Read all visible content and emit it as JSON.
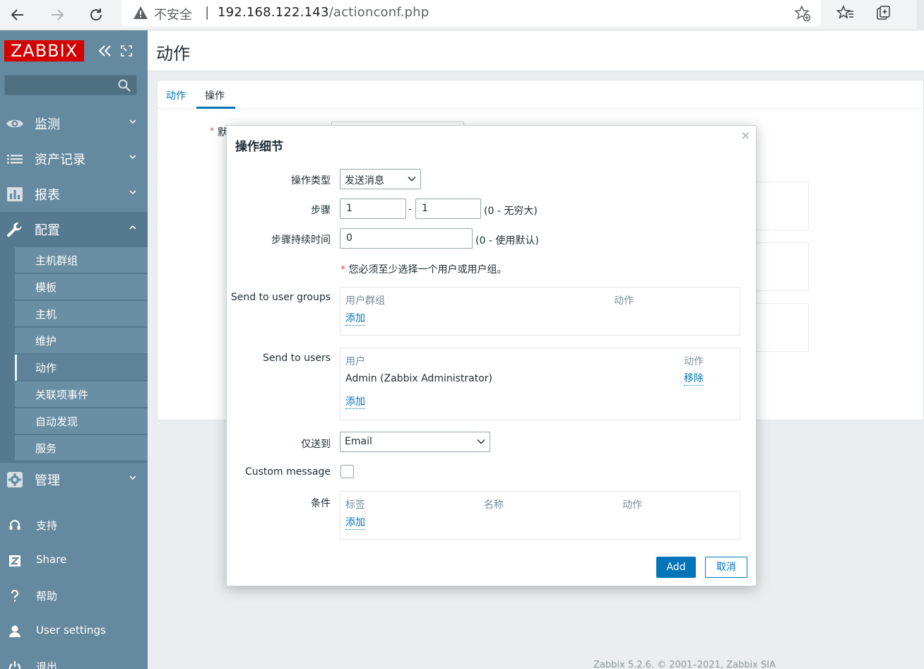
{
  "browser": {
    "security_label": "不安全",
    "separator": "|",
    "url_host": "192.168.122.143",
    "url_path": "/actionconf.php"
  },
  "sidebar": {
    "logo": "ZABBIX",
    "nav": [
      {
        "label": "监测",
        "icon": "eye-icon"
      },
      {
        "label": "资产记录",
        "icon": "list-icon"
      },
      {
        "label": "报表",
        "icon": "bar-chart-icon"
      },
      {
        "label": "配置",
        "icon": "wrench-icon"
      },
      {
        "label": "管理",
        "icon": "gear-icon"
      }
    ],
    "subnav": [
      "主机群组",
      "模板",
      "主机",
      "维护",
      "动作",
      "关联项事件",
      "自动发现",
      "服务"
    ],
    "bottom": [
      {
        "label": "支持",
        "icon": "headset-icon"
      },
      {
        "label": "Share",
        "icon": "share-z-icon"
      },
      {
        "label": "帮助",
        "icon": "question-icon"
      },
      {
        "label": "User settings",
        "icon": "user-icon"
      },
      {
        "label": "退出",
        "icon": "power-icon"
      }
    ]
  },
  "main": {
    "title": "动作",
    "tabs": [
      "动作",
      "操作"
    ],
    "bg_required_fragment": "默"
  },
  "footer": "Zabbix 5.2.6. © 2001–2021, Zabbix SIA",
  "modal": {
    "title": "操作细节",
    "close": "×",
    "op_type_label": "操作类型",
    "op_type_value": "发送消息",
    "steps_label": "步骤",
    "step_from": "1",
    "step_dash": "-",
    "step_to": "1",
    "steps_hint": "(0 - 无穷大)",
    "duration_label": "步骤持续时间",
    "duration_value": "0",
    "duration_hint": "(0 - 使用默认)",
    "required_star": "*",
    "required_note": "您必须至少选择一个用户或用户组。",
    "user_groups_label": "Send to user groups",
    "user_groups": {
      "col1": "用户群组",
      "col2": "动作",
      "add": "添加"
    },
    "users_label": "Send to users",
    "users": {
      "col1": "用户",
      "col2": "动作",
      "rows": [
        {
          "name": "Admin (Zabbix Administrator)",
          "action": "移除"
        }
      ],
      "add": "添加"
    },
    "send_only_label": "仅送到",
    "send_only_value": "Email",
    "custom_message_label": "Custom message",
    "conditions_label": "条件",
    "conditions": {
      "col1": "标签",
      "col2": "名称",
      "col3": "动作",
      "add": "添加"
    },
    "add_button": "Add",
    "cancel_button": "取消"
  },
  "colors": {
    "brand": "#d40000",
    "sidebar": "#65899f",
    "link": "#0275b8"
  }
}
